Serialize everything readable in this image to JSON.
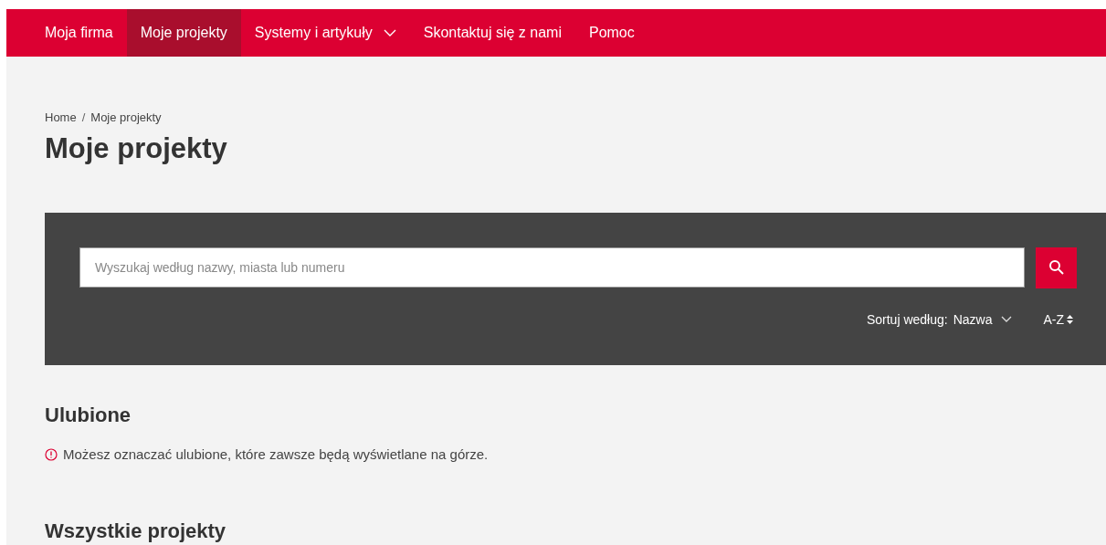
{
  "nav": [
    {
      "label": "Moja firma",
      "selected": false,
      "dropdown": false
    },
    {
      "label": "Moje projekty",
      "selected": true,
      "dropdown": false
    },
    {
      "label": "Systemy i artykuły",
      "selected": false,
      "dropdown": true
    },
    {
      "label": "Skontaktuj się z nami",
      "selected": false,
      "dropdown": false
    },
    {
      "label": "Pomoc",
      "selected": false,
      "dropdown": false
    }
  ],
  "breadcrumb": [
    "Home",
    "Moje projekty"
  ],
  "breadcrumb_separator": "/",
  "page_title": "Moje projekty",
  "search": {
    "placeholder": "Wyszukaj według nazwy, miasta lub numeru"
  },
  "sort": {
    "label": "Sortuj według:",
    "value": "Nazwa",
    "order": "A-Z"
  },
  "favorites": {
    "title": "Ulubione",
    "info": "Możesz oznaczać ulubione, które zawsze będą wyświetlane na górze."
  },
  "all_projects": {
    "title": "Wszystkie projekty"
  }
}
